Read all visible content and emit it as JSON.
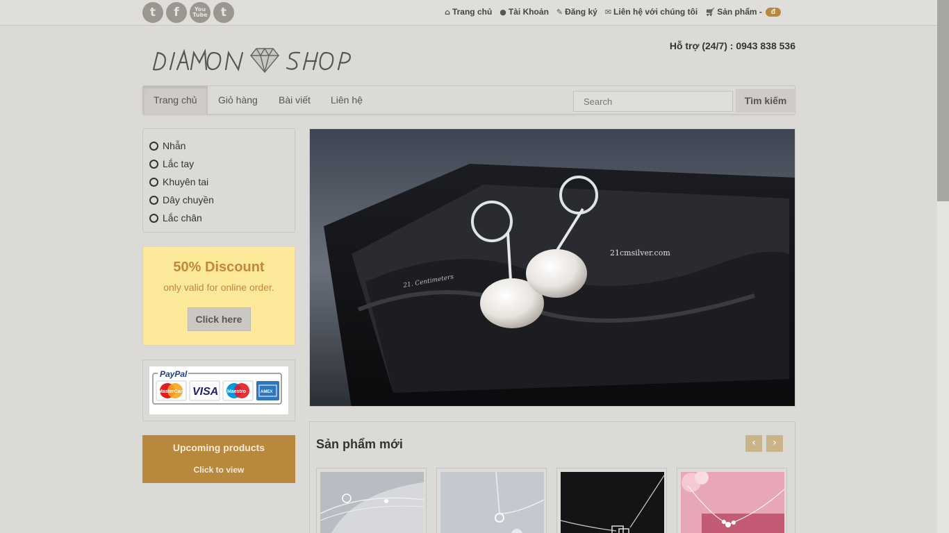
{
  "social": [
    {
      "name": "twitter-icon",
      "glyph": "t"
    },
    {
      "name": "facebook-icon",
      "glyph": "f"
    },
    {
      "name": "youtube-icon",
      "glyph": "You\nTube"
    },
    {
      "name": "tumblr-icon",
      "glyph": "t"
    }
  ],
  "toplinks": {
    "home": {
      "icon": "home-icon",
      "label": "Trang chủ"
    },
    "account": {
      "icon": "user-icon",
      "label": "Tài Khoản"
    },
    "register": {
      "icon": "edit-icon",
      "label": "Đăng ký"
    },
    "contact": {
      "icon": "envelope-icon",
      "label": "Liên hệ với chúng tôi"
    },
    "products": {
      "icon": "cart-icon",
      "label": "Sản phẩm -",
      "badge": "đ"
    }
  },
  "support": "Hỗ trợ (24/7) : 0943 838 536",
  "logo": {
    "text": "DIAMON SHOP"
  },
  "nav": {
    "items": [
      "Trang chủ",
      "Giỏ hàng",
      "Bài viết",
      "Liên hệ"
    ],
    "active": "Trang chủ",
    "search_placeholder": "Search",
    "search_button": "Tìm kiếm"
  },
  "categories": [
    "Nhẫn",
    "Lắc tay",
    "Khuyên tai",
    "Dây chuyền",
    "Lắc chân"
  ],
  "discount": {
    "title": "50% Discount",
    "subtitle": "only valid for online order.",
    "button": "Click here"
  },
  "payment": {
    "label": "PayPal",
    "cards": [
      "MasterCard",
      "VISA",
      "Maestro",
      "AmEx"
    ]
  },
  "upcoming": {
    "title": "Upcoming products",
    "link": "Click to view"
  },
  "hero": {
    "watermark": "21cmsilver.com",
    "signature": "21. Centimeters"
  },
  "new_products": {
    "title": "Sản phẩm mới",
    "prev": "‹",
    "next": "›"
  },
  "colors": {
    "accent": "#b8883d",
    "discount_bg": "#fde99a",
    "background": "#dcdad6"
  }
}
